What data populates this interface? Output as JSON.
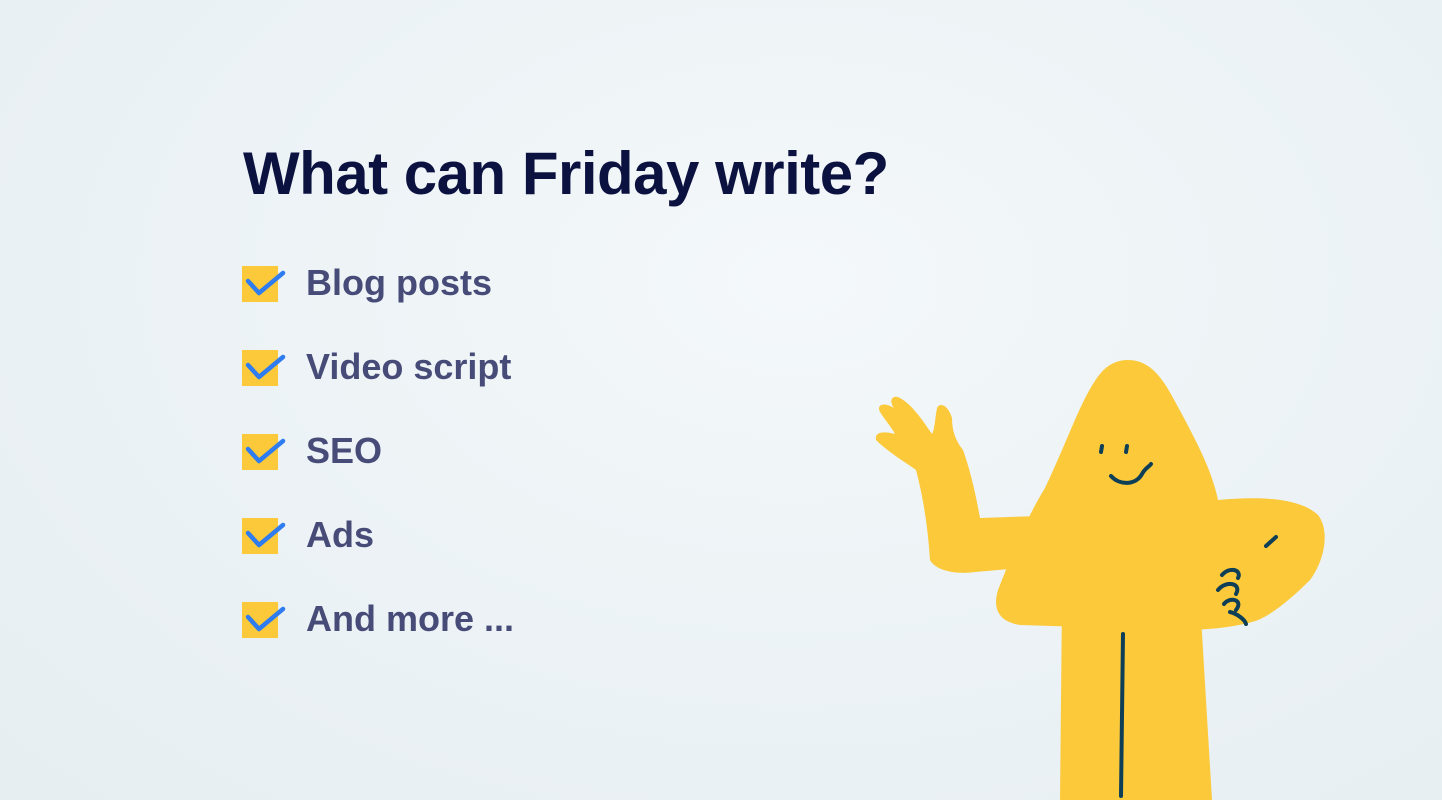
{
  "heading": "What can Friday write?",
  "features": [
    {
      "label": "Blog posts"
    },
    {
      "label": "Video script"
    },
    {
      "label": "SEO"
    },
    {
      "label": "Ads"
    },
    {
      "label": "And more ..."
    }
  ],
  "colors": {
    "heading": "#0c1240",
    "label": "#474b78",
    "checkbox_fill": "#fcc93a",
    "checkmark": "#2f7cf0",
    "mascot_body": "#fcc93a",
    "mascot_line": "#0e3f56"
  },
  "icons": {
    "checkbox": "checkbox-checked-icon",
    "mascot": "waving-mascot-illustration"
  }
}
